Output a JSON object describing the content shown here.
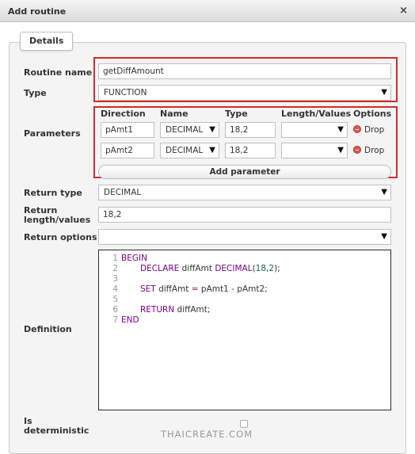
{
  "dialog": {
    "title": "Add routine",
    "close_glyph": "×"
  },
  "details_legend": "Details",
  "routine_name": {
    "label": "Routine name",
    "value": "getDiffAmount"
  },
  "type": {
    "label": "Type",
    "value": "FUNCTION"
  },
  "parameters": {
    "label": "Parameters",
    "headers": [
      "Direction",
      "Name",
      "Type",
      "Length/Values",
      "Options"
    ],
    "rows": [
      {
        "name": "pAmt1",
        "type": "DECIMAL",
        "length": "18,2",
        "length_values": "",
        "drop": "Drop"
      },
      {
        "name": "pAmt2",
        "type": "DECIMAL",
        "length": "18,2",
        "length_values": "",
        "drop": "Drop"
      }
    ],
    "add_button": "Add parameter"
  },
  "return_type": {
    "label": "Return type",
    "value": "DECIMAL"
  },
  "return_length": {
    "label_line1": "Return",
    "label_line2": "length/values",
    "value": "18,2"
  },
  "return_options": {
    "label": "Return options",
    "value": ""
  },
  "definition": {
    "label": "Definition",
    "line_numbers": [
      "1",
      "2",
      "3",
      "4",
      "5",
      "6",
      "7"
    ],
    "code": [
      "BEGIN",
      "DECLARE diffAmt DECIMAL(18,2);",
      "",
      "SET diffAmt = pAmt1 - pAmt2;",
      "",
      "RETURN diffAmt;",
      "END"
    ]
  },
  "is_deterministic": {
    "label_line1": "Is",
    "label_line2": "deterministic",
    "checked": false
  },
  "watermark": "THAICREATE.COM",
  "colors": {
    "highlight_border": "#d12b2b",
    "keyword": "#770088",
    "number": "#116644",
    "operator": "#981a1a"
  },
  "icons": {
    "drop": "minus-circle-icon",
    "select_arrow": "triangle-down-icon",
    "close": "close-icon"
  }
}
